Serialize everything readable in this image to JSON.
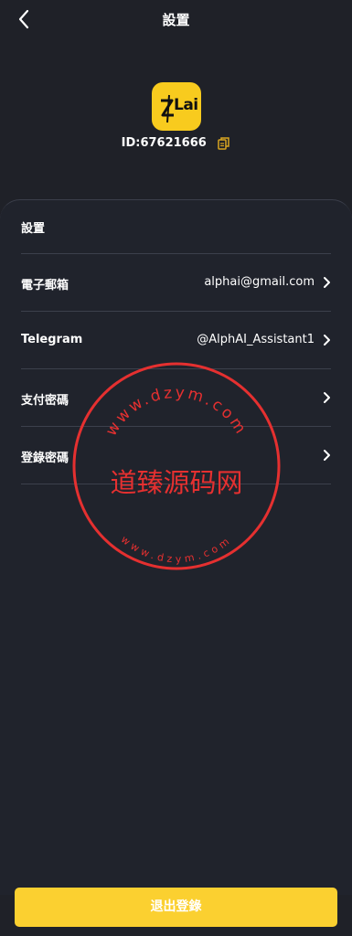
{
  "header": {
    "title": "設置"
  },
  "profile": {
    "logo_text": "Lai",
    "user_id": "ID:67621666"
  },
  "settings": {
    "section_title": "設置",
    "rows": [
      {
        "label": "電子郵箱",
        "value": "alphai@gmail.com"
      },
      {
        "label": "Telegram",
        "value": "@AlphAI_Assistant1"
      },
      {
        "label": "支付密碼",
        "value": ""
      },
      {
        "label": "登錄密碼",
        "value": ""
      }
    ]
  },
  "watermark": {
    "text": "道臻源码网",
    "ring_top": "www.dzym.com",
    "ring_bottom": "www.dzym.com"
  },
  "footer": {
    "logout_label": "退出登錄"
  },
  "colors": {
    "accent": "#fbd030",
    "background": "#1f2128",
    "watermark": "#e53030"
  }
}
